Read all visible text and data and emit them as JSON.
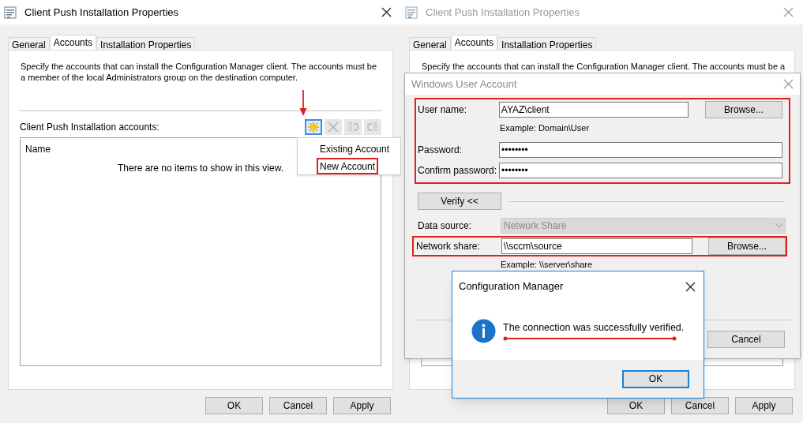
{
  "left": {
    "window": {
      "title": "Client Push Installation Properties",
      "active": true
    },
    "tabs": [
      {
        "label": "General",
        "selected": false
      },
      {
        "label": "Accounts",
        "selected": true
      },
      {
        "label": "Installation Properties",
        "selected": false
      }
    ],
    "description": "Specify the accounts that can install the Configuration Manager client. The accounts must be a member of the local Administrators group on the destination computer.",
    "accounts_label": "Client Push Installation accounts:",
    "toolbar": [
      {
        "kind": "new",
        "disabled": false
      },
      {
        "kind": "delete",
        "disabled": true
      },
      {
        "kind": "move_up",
        "disabled": true
      },
      {
        "kind": "move_down",
        "disabled": true
      }
    ],
    "list": {
      "columns": [
        "Name"
      ],
      "empty_text": "There are no items to show in this view."
    },
    "add_menu": {
      "items": [
        {
          "label": "Existing Account",
          "marked": false
        },
        {
          "label": "New Account",
          "marked": true
        }
      ]
    },
    "buttons": [
      "OK",
      "Cancel",
      "Apply"
    ]
  },
  "right": {
    "window": {
      "title": "Client Push Installation Properties",
      "active": false
    },
    "tabs": [
      {
        "label": "General",
        "selected": false
      },
      {
        "label": "Accounts",
        "selected": true
      },
      {
        "label": "Installation Properties",
        "selected": false
      }
    ],
    "description": "Specify the accounts that can install the Configuration Manager client. The accounts must be a",
    "buttons": [
      "OK",
      "Cancel",
      "Apply"
    ],
    "account_dialog": {
      "title": "Windows User Account",
      "credentials": [
        {
          "label": "User name:",
          "value": "AYAZ\\client",
          "example": "Example: Domain\\User",
          "browse": "Browse..."
        },
        {
          "label": "Password:",
          "value": "••••••••"
        },
        {
          "label": "Confirm password:",
          "value": "••••••••"
        }
      ],
      "verify_button": "Verify <<",
      "data_source": {
        "label": "Data source:",
        "value": "Network Share",
        "disabled": true
      },
      "network_share": {
        "label": "Network share:",
        "value": "\\\\sccm\\source",
        "example": "Example: \\\\server\\share",
        "browse": "Browse..."
      },
      "buttons": [
        "Cancel"
      ]
    },
    "message_box": {
      "title": "Configuration Manager",
      "message": "The connection was successfully verified.",
      "buttons": [
        "OK"
      ]
    }
  }
}
